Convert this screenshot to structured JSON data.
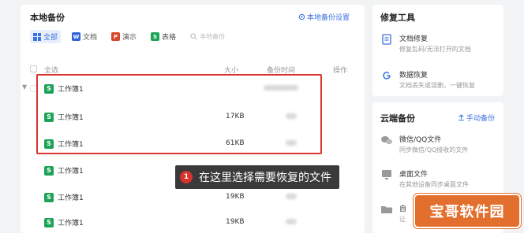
{
  "main": {
    "title": "本地备份",
    "settings_link": "本地备份设置",
    "tabs": [
      {
        "label": "全部",
        "icon": "grid-icon",
        "color": "#3c72e0"
      },
      {
        "label": "文档",
        "icon": "W",
        "color": "#2f62d8"
      },
      {
        "label": "演示",
        "icon": "P",
        "color": "#d9472b"
      },
      {
        "label": "表格",
        "icon": "S",
        "color": "#1da357"
      }
    ],
    "search_placeholder": "本地备份",
    "columns": {
      "select_all": "全选",
      "size": "大小",
      "time": "备份时间",
      "action": "操作"
    },
    "rows": [
      {
        "name": "工作簿1",
        "size": ""
      },
      {
        "name": "工作簿1",
        "size": "17KB"
      },
      {
        "name": "工作簿1",
        "size": "61KB"
      },
      {
        "name": "工作簿1",
        "size": ""
      },
      {
        "name": "工作簿1",
        "size": "19KB"
      },
      {
        "name": "工作簿1",
        "size": "19KB"
      }
    ]
  },
  "tooltip": {
    "step": "1",
    "text": "在这里选择需要恢复的文件"
  },
  "repair": {
    "title": "修复工具",
    "items": [
      {
        "title": "文档修复",
        "desc": "修复乱码/无法打开的文档"
      },
      {
        "title": "数据恢复",
        "desc": "文档丢失或误删，一键恢复"
      }
    ]
  },
  "cloud": {
    "title": "云端备份",
    "manual_link": "手动备份",
    "items": [
      {
        "title": "微信/QQ文件",
        "desc": "同步微信/QQ接收的文件"
      },
      {
        "title": "桌面文件",
        "desc": "在其他设备同步桌面文件"
      },
      {
        "title": "自",
        "desc": "让"
      }
    ]
  },
  "watermark": "宝哥软件园",
  "colors": {
    "accent": "#3c72e0",
    "highlight": "#d9342b",
    "sheet": "#1da357"
  }
}
